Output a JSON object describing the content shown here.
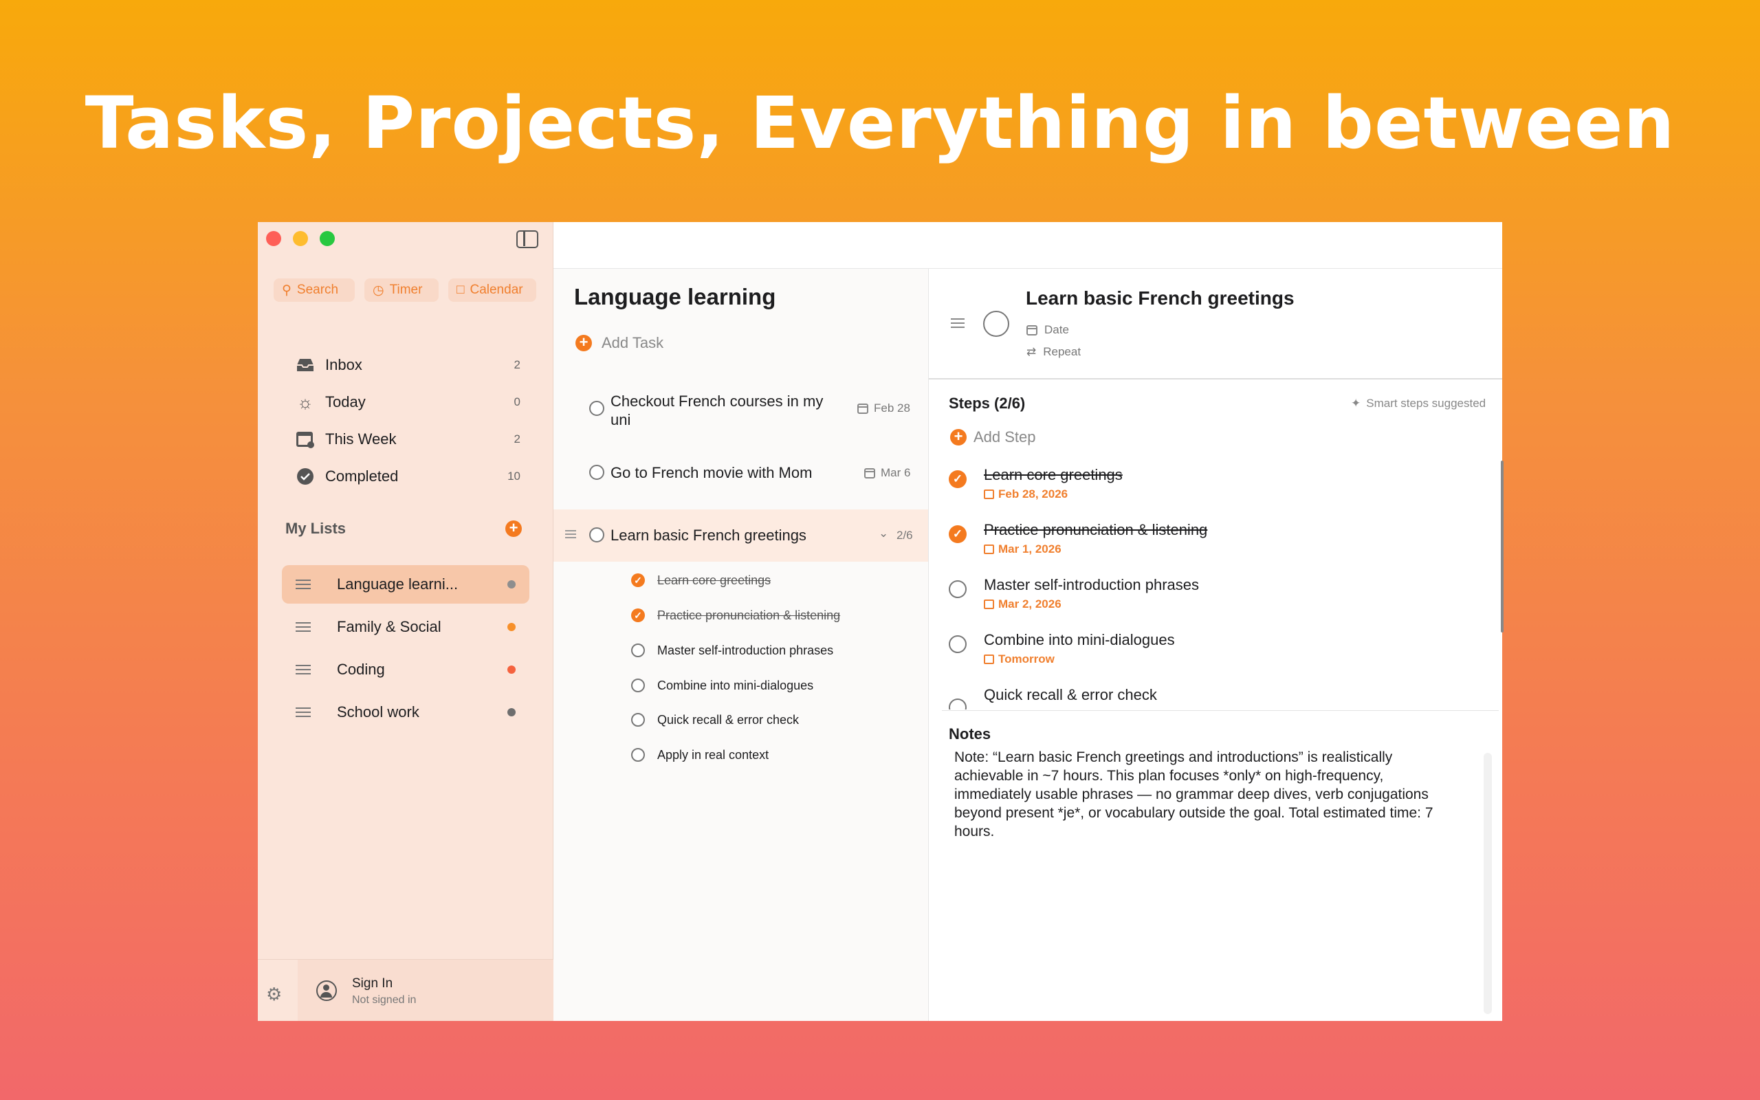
{
  "headline": "Tasks, Projects, Everything in between",
  "sidebar": {
    "quick_actions": [
      {
        "label": "Search",
        "icon": "search-icon"
      },
      {
        "label": "Timer",
        "icon": "timer-icon"
      },
      {
        "label": "Calendar",
        "icon": "calendar-icon"
      }
    ],
    "nav": [
      {
        "label": "Inbox",
        "count": "2",
        "icon": "inbox-icon"
      },
      {
        "label": "Today",
        "count": "0",
        "icon": "sun-icon"
      },
      {
        "label": "This Week",
        "count": "2",
        "icon": "week-calendar-icon"
      },
      {
        "label": "Completed",
        "count": "10",
        "icon": "checkmark-circle-icon"
      }
    ],
    "my_lists_label": "My Lists",
    "lists": [
      {
        "label": "Language learni...",
        "dot_color": "#8e8e8e"
      },
      {
        "label": "Family & Social",
        "dot_color": "#f7902a"
      },
      {
        "label": "Coding",
        "dot_color": "#f5623e"
      },
      {
        "label": "School work",
        "dot_color": "#6e6e6e"
      }
    ],
    "sign_in": "Sign In",
    "sign_in_status": "Not signed in"
  },
  "middle": {
    "title": "Language learning",
    "add_task": "Add Task",
    "tasks": [
      {
        "title": "Checkout French courses in my uni",
        "date": "Feb 28"
      },
      {
        "title": "Go to French movie with Mom",
        "date": "Mar 6"
      },
      {
        "title": "Learn basic French greetings",
        "progress": "2/6"
      }
    ],
    "subtasks": [
      {
        "title": "Learn core greetings",
        "done": true
      },
      {
        "title": "Practice pronunciation & listening",
        "done": true
      },
      {
        "title": "Master self-introduction phrases",
        "done": false
      },
      {
        "title": "Combine into mini-dialogues",
        "done": false
      },
      {
        "title": "Quick recall & error check",
        "done": false
      },
      {
        "title": "Apply in real context",
        "done": false
      }
    ]
  },
  "detail": {
    "title": "Learn basic French greetings",
    "date_label": "Date",
    "repeat_label": "Repeat",
    "steps_title": "Steps (2/6)",
    "smart_steps": "Smart steps suggested",
    "add_step": "Add Step",
    "steps": [
      {
        "title": "Learn core greetings",
        "date": "Feb 28, 2026",
        "done": true
      },
      {
        "title": "Practice pronunciation & listening",
        "date": "Mar 1, 2026",
        "done": true
      },
      {
        "title": "Master self-introduction phrases",
        "date": "Mar 2, 2026",
        "done": false
      },
      {
        "title": "Combine into mini-dialogues",
        "date": "Tomorrow",
        "done": false
      },
      {
        "title": "Quick recall & error check",
        "date": "",
        "done": false
      }
    ],
    "notes_title": "Notes",
    "notes": "Note: “Learn basic French greetings and introductions” is realistically achievable in ~7 hours. This plan focuses *only* on high-frequency, immediately usable phrases — no grammar deep dives, verb conjugations beyond present *je*, or vocabulary outside the goal. Total estimated time: 7 hours."
  },
  "colors": {
    "accent": "#f47a1f",
    "sidebar_bg": "#fbe5da",
    "active_list": "#f7c7a9"
  }
}
